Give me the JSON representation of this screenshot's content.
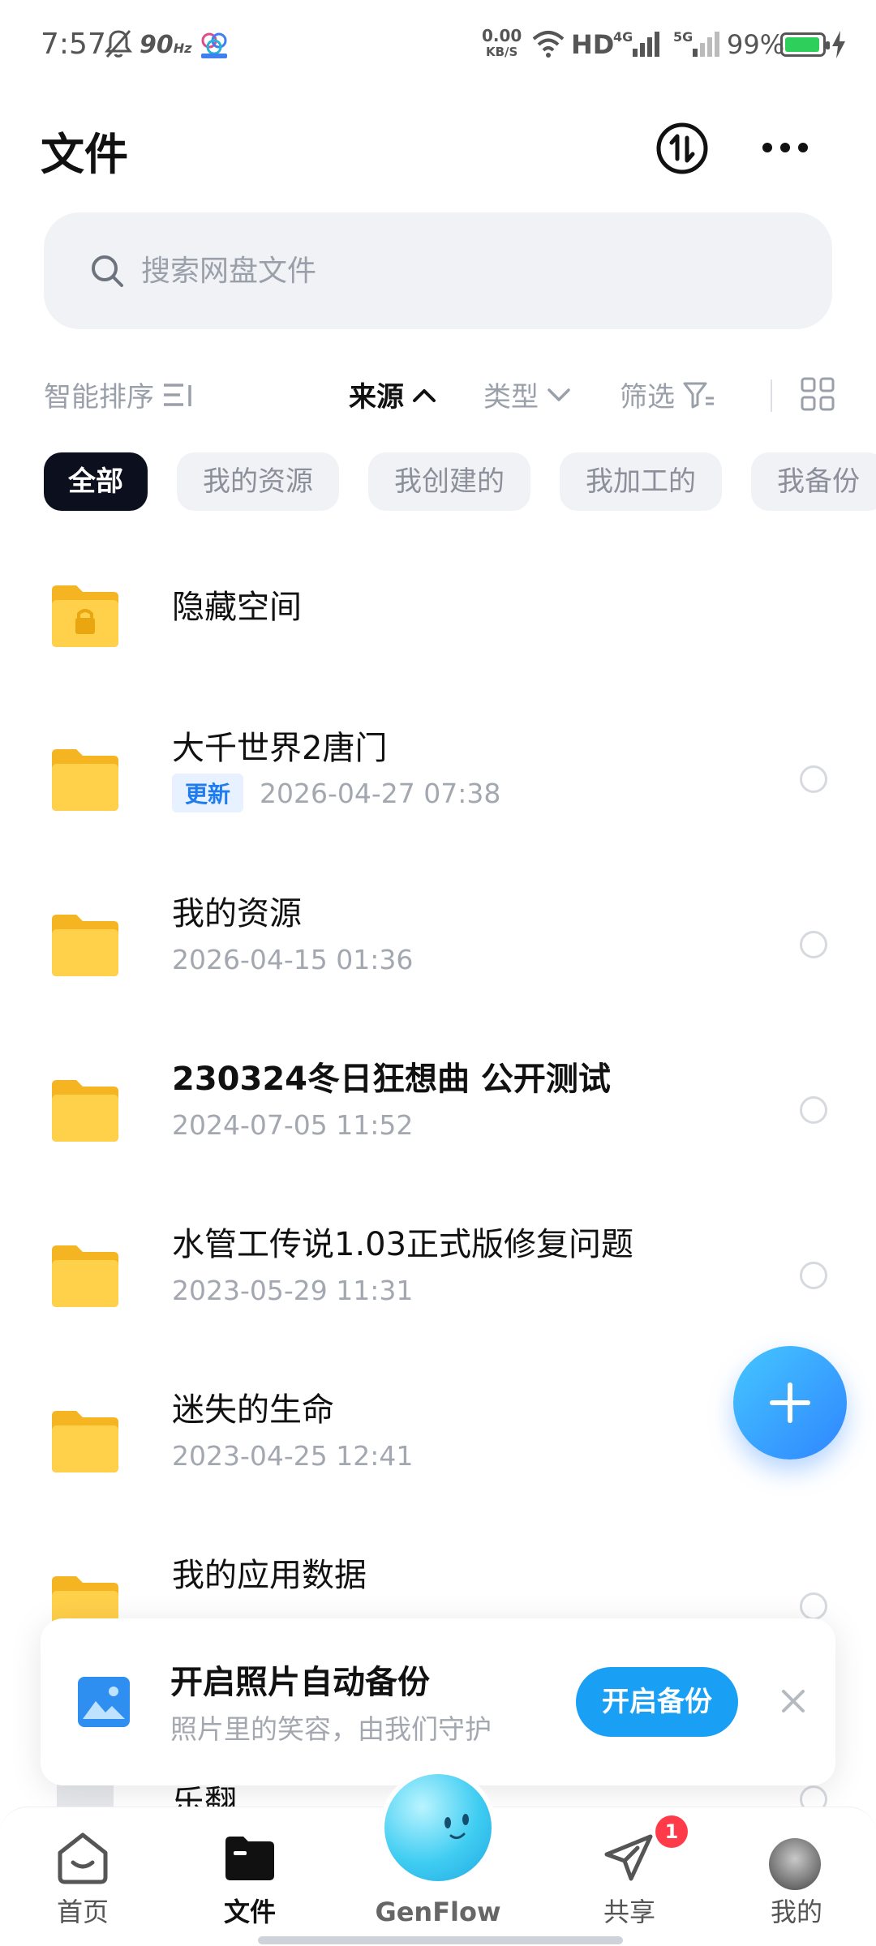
{
  "status_bar": {
    "time": "7:57",
    "refresh_rate": "90",
    "refresh_unit": "Hz",
    "net_speed_value": "0.00",
    "net_speed_unit": "KB/S",
    "hd": "HD",
    "sig1": "4G",
    "sig2": "5G",
    "battery": "99%",
    "battery_color": "#2ed05b"
  },
  "header": {
    "title": "文件",
    "transfer_icon": "transfer-icon",
    "more_icon": "more-icon"
  },
  "search": {
    "placeholder": "搜索网盘文件",
    "value": ""
  },
  "toolbar": {
    "sort_label": "智能排序",
    "source_label": "来源",
    "type_label": "类型",
    "filter_label": "筛选"
  },
  "chips": [
    "全部",
    "我的资源",
    "我创建的",
    "我加工的",
    "我备份"
  ],
  "files": [
    {
      "name": "隐藏空间",
      "meta": "",
      "tag": "",
      "locked": true
    },
    {
      "name": "大千世界2唐门",
      "meta": "2026-04-27  07:38",
      "tag": "更新",
      "locked": false
    },
    {
      "name": "我的资源",
      "meta": "2026-04-15  01:36",
      "tag": "",
      "locked": false
    },
    {
      "name": "230324冬日狂想曲 公开测试",
      "meta": "2024-07-05  11:52",
      "tag": "",
      "locked": false
    },
    {
      "name": "水管工传说1.03正式版修复问题",
      "meta": "2023-05-29  11:31",
      "tag": "",
      "locked": false
    },
    {
      "name": "迷失的生命",
      "meta": "2023-04-25  12:41",
      "tag": "",
      "locked": false
    },
    {
      "name": "我的应用数据",
      "meta": "",
      "tag": "",
      "locked": false
    }
  ],
  "peek_file": {
    "name": "乐翻"
  },
  "backup": {
    "title": "开启照片自动备份",
    "subtitle": "照片里的笑容，由我们守护",
    "button": "开启备份",
    "accent": "#19a0f5"
  },
  "nav": {
    "home": "首页",
    "files": "文件",
    "genflow": "GenFlow",
    "share": "共享",
    "share_badge": "1",
    "mine": "我的"
  },
  "colors": {
    "folder": "#ffc83d",
    "fab_start": "#45c6ff",
    "fab_end": "#2f86ff",
    "update_tag": "#1f7cf0"
  }
}
